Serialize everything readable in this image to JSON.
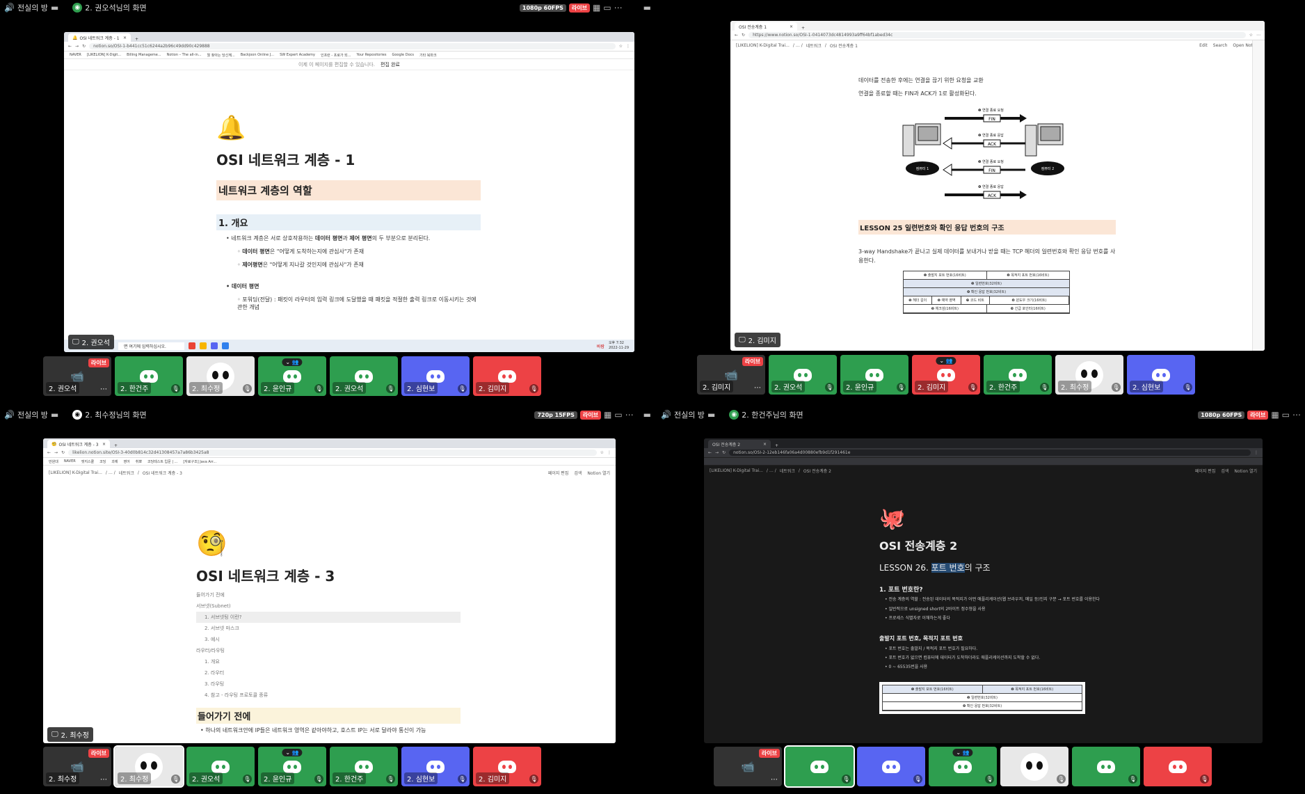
{
  "q1": {
    "channel": "전실의 방",
    "viewer": "2. 권오석님의 화면",
    "resolution": "1080p 60FPS",
    "live": "라이브",
    "browser": {
      "tab_title": "OSI 네트워크 계층 - 1",
      "url": "notion.so/OSI-1-b441cc51c6244a2b96c49dd90c429888",
      "bookmarks": [
        "NAVER",
        "[LIKELION] K-Digit...",
        "Billing Manageme...",
        "Notion – The all-in...",
        "뭘 찾아는 당신께...",
        "Backjoon Online J...",
        "SW Expert Academy",
        "인프런 - 프로가 되...",
        "Your Repositories",
        "Google Docs",
        "기타 북마크"
      ],
      "notice": "이제 이 페이지를 편집할 수 있습니다.",
      "notice_action": "편집 완료"
    },
    "page": {
      "title": "OSI 네트워크 계층 - 1",
      "h2": "네트워크 계층의 역할",
      "h3": "1. 개요",
      "b1_pre": "네트워크 계층은 서로 상호작용하는 ",
      "b1_bold1": "데이터 평면",
      "b1_mid": "과 ",
      "b1_bold2": "제어 평면",
      "b1_post": "의 두 부분으로 분리된다.",
      "sub1_bold": "데이터 평면",
      "sub1_text": "은 \"어떻게 도착하는지에 관심사\"가 존재",
      "sub2_bold": "제어평면",
      "sub2_text": "은 \"어떻게 지나갈 것인지에 관심사\"가 존재",
      "b2": "데이터 평면",
      "sub3": "포워딩(전달) : 패킷이 라우터의 입력 링크에 도달했을 때 패킷을 적절한 출력 링크로 이동시키는 것에 관한 개념"
    },
    "taskbar": {
      "search": "면 여기에 입력하십시오.",
      "weather": "바람",
      "time": "오후 7:32",
      "date": "2022-11-29"
    },
    "screen_label": "2. 권오석",
    "tiles": [
      {
        "name": "2. 권오석",
        "style": "cam",
        "live": "라이브"
      },
      {
        "name": "2. 한건주",
        "style": "green"
      },
      {
        "name": "2. 최수정",
        "style": "white"
      },
      {
        "name": "2. 윤인규",
        "style": "green",
        "icon": true
      },
      {
        "name": "2. 권오석",
        "style": "green"
      },
      {
        "name": "2. 심현보",
        "style": "blue"
      },
      {
        "name": "2. 김미지",
        "style": "red"
      }
    ]
  },
  "q2": {
    "browser": {
      "tab_title": "OSI 전송계층 1",
      "url": "https://www.notion.so/OSI-1-0414073dc4814993a9ff64bf1abed34c",
      "crumb1": "[LIKELION] K-Digital Trai...",
      "crumb2": "네트워크",
      "crumb3": "OSI 전송계층 1",
      "edit": "Edit",
      "search": "Search",
      "open": "Open Notion"
    },
    "page": {
      "p1": "데이터를 전송한 후에는 연결을 끊기 위한 요청을 교환",
      "p2": "연결을 종료할 때는 FIN과 ACK가 1로 활성화된다.",
      "diagram": {
        "s1": "❶ 연결 종료 요청",
        "m1": "FIN",
        "s2": "❷ 연결 종료 응답",
        "m2": "ACK",
        "s3": "❸ 연결 종료 요청",
        "m3": "FIN",
        "s4": "❹ 연결 종료 응답",
        "m4": "ACK",
        "pc1": "컴퓨터 1",
        "pc2": "컴퓨터 2"
      },
      "lesson": "LESSON 25 일련번호와 확인 응답 번호의 구조",
      "p3": "3-way Handshake가 끝나고 실제 데이터를 보내거나 받을 때는 TCP 헤더의 일련번호와 확인 응답 번호를 사용한다.",
      "table": [
        "❶ 출발지 포트 번호(16비트)",
        "❷ 목적지 포트 번호(16비트)",
        "❸ 일련번호(32비트)",
        "❹ 확인 응답 번호(32비트)",
        "❺ 헤더 길이",
        "❻ 예약 영역",
        "❼ 코드 비트",
        "❽ 윈도우 크기(16비트)",
        "❾ 체크섬(16비트)",
        "❿ 긴급 포인터(16비트)"
      ]
    },
    "screen_label": "2. 김미지",
    "tiles": [
      {
        "name": "2. 김미지",
        "style": "cam",
        "live": "라이브"
      },
      {
        "name": "2. 권오석",
        "style": "green"
      },
      {
        "name": "2. 윤인규",
        "style": "green"
      },
      {
        "name": "2. 김미지",
        "style": "red",
        "icon": true
      },
      {
        "name": "2. 한건주",
        "style": "green"
      },
      {
        "name": "2. 최수정",
        "style": "white"
      },
      {
        "name": "2. 심현보",
        "style": "blue"
      }
    ]
  },
  "q3": {
    "channel": "전실의 방",
    "viewer": "2. 최수정님의 화면",
    "resolution": "720p 15FPS",
    "live": "라이브",
    "browser": {
      "tab_title": "OSI 네트워크 계층 - 3",
      "url": "likelion.notion.site/OSI-3-40d0b814c32d41308457a7a86b3425a8",
      "bookmarks": [
        "만원대",
        "NAVER",
        "엣지스쿨",
        "코딩",
        "과제",
        "영어",
        "취뽀",
        "코딩테스트 입문 | ...",
        "[자료구조] Java Arr..."
      ],
      "crumb1": "[LIKELION] K-Digital Trai...",
      "crumb2": "네트워크",
      "crumb3": "OSI 네트워크 계층 - 3",
      "edit": "페이지 편집",
      "search": "검색",
      "open": "Notion 열기"
    },
    "page": {
      "title": "OSI 네트워크 계층 - 3",
      "toc": [
        "들어가기 전에",
        "서브넷(Subnet)",
        "1. 서브넷팅 이란?",
        "2. 서브넷 마스크",
        "3. 예시",
        "라우터/라우팅",
        "1. 개요",
        "2. 라우터",
        "3. 라우팅",
        "4. 참고 - 라우팅 프로토콜 종류"
      ],
      "h2": "들어가기 전에",
      "p1": "하나의 네트워크안에 IP들은 네트워크 영역은 같아야하고, 호스트 IP는 서로 달라야 통신이 가능"
    },
    "screen_label": "2. 최수정",
    "tiles": [
      {
        "name": "2. 최수정",
        "style": "cam",
        "live": "라이브"
      },
      {
        "name": "2. 최수정",
        "style": "white",
        "sel": true
      },
      {
        "name": "2. 권오석",
        "style": "green"
      },
      {
        "name": "2. 윤인규",
        "style": "green",
        "icon": true
      },
      {
        "name": "2. 한건주",
        "style": "green"
      },
      {
        "name": "2. 심현보",
        "style": "blue"
      },
      {
        "name": "2. 김미지",
        "style": "red"
      }
    ]
  },
  "q4": {
    "channel": "전실의 방",
    "viewer": "2. 한건주님의 화면",
    "resolution": "1080p 60FPS",
    "live": "라이브",
    "browser": {
      "tab_title": "OSI 전송계층 2",
      "url": "notion.so/OSI-2-12eb146fa06a4d00880efb9d1f291461e",
      "crumb1": "[LIKELION] K-Digital Trai...",
      "crumb2": "네트워크",
      "crumb3": "OSI 전송계층 2",
      "edit": "페이지 편집",
      "search": "검색",
      "open": "Notion 열기"
    },
    "page": {
      "title": "OSI 전송계층 2",
      "lesson_pre": "LESSON 26. ",
      "lesson_hl": "포트 번호",
      "lesson_post": "의 구조",
      "h3a": "1. 포트 번호란?",
      "a1": "전송 계층의 역할 : 전송된 데이터의 목적지가 어떤 애플리케이션(웹 브라우저, 메일 등)인지 구분 → 포트 번호를 이용한다",
      "a2": "일반적으로 unsigned short의 2바이트 정수형을 사용",
      "a3": "프로세스 식별자로 이해하는게 좋다",
      "h3b": "출발지 포트 번호, 목적지 포트 번호",
      "b1": "포트 번호는 출발지 / 목적지 포트 번호가 필요하다.",
      "b2": "포트 번호가 없으면 컴퓨터에 데이터가 도착하더라도 애플리케이션까지 도착할 수 없다.",
      "b3": "0 ~ 65535번을 사용",
      "table": [
        "❶ 출발지 포트 번호(16비트)",
        "❷ 목적지 포트 번호(16비트)",
        "❸ 일련번호(32비트)",
        "❹ 확인 응답 번호(32비트)"
      ]
    },
    "tiles": [
      {
        "name": "",
        "style": "cam",
        "live": "라이브"
      },
      {
        "name": "",
        "style": "green",
        "sel": true
      },
      {
        "name": "",
        "style": "blue"
      },
      {
        "name": "",
        "style": "green",
        "icon": true
      },
      {
        "name": "",
        "style": "white"
      },
      {
        "name": "",
        "style": "green"
      },
      {
        "name": "",
        "style": "red"
      }
    ]
  }
}
